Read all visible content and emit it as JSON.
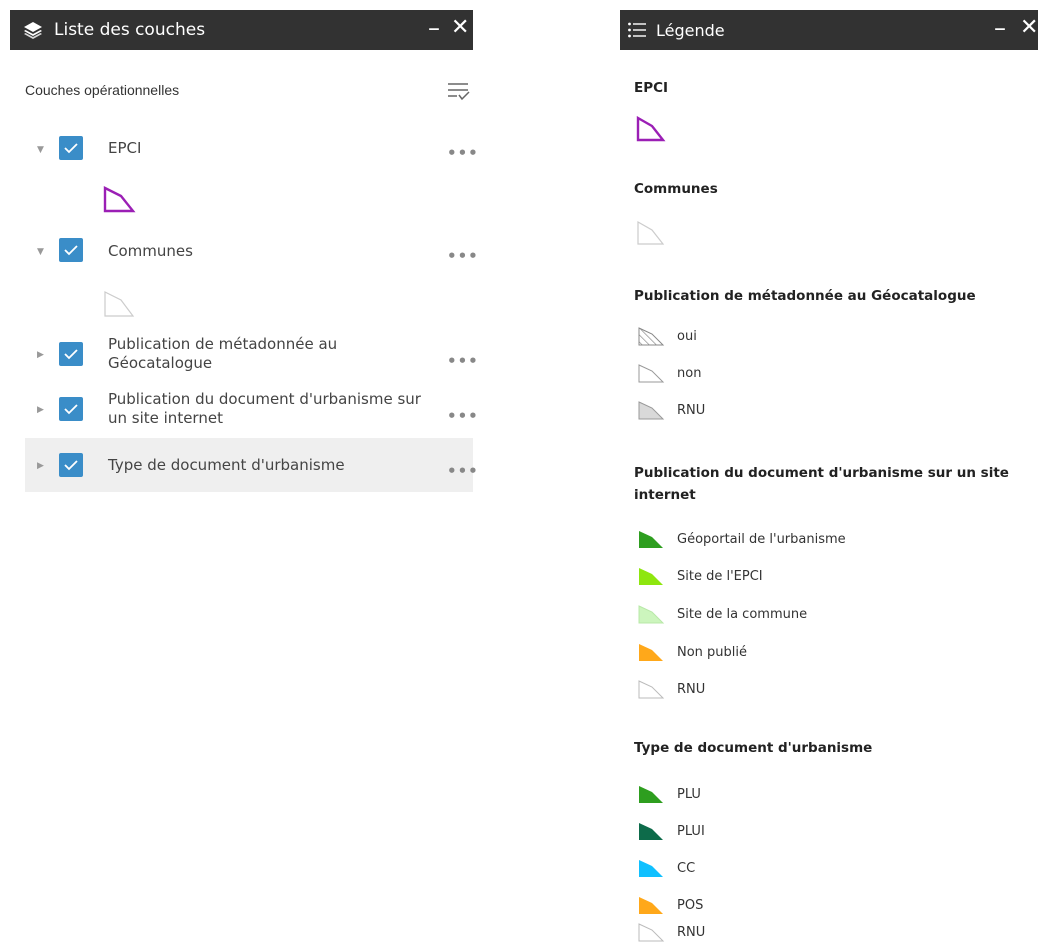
{
  "layers_panel": {
    "title": "Liste des couches",
    "minimize": "–",
    "close": "✕",
    "section_title": "Couches opérationnelles",
    "more": "•••",
    "layers": [
      {
        "label": "EPCI",
        "checked": true,
        "expanded": true
      },
      {
        "label": "Communes",
        "checked": true,
        "expanded": true
      },
      {
        "label": "Publication de métadonnée au Géocatalogue",
        "checked": true,
        "expanded": false
      },
      {
        "label": "Publication du document d'urbanisme sur un site internet",
        "checked": true,
        "expanded": false
      },
      {
        "label": "Type de document d'urbanisme",
        "checked": true,
        "expanded": false
      }
    ]
  },
  "legend_panel": {
    "title": "Légende",
    "minimize": "–",
    "close": "✕",
    "groups": [
      {
        "heading": "EPCI",
        "items": [
          {
            "label": "",
            "fill": "none",
            "stroke": "#9b1fb5"
          }
        ]
      },
      {
        "heading": "Communes",
        "items": [
          {
            "label": "",
            "fill": "#ffffff",
            "stroke": "#cccccc"
          }
        ]
      },
      {
        "heading": "Publication de métadonnée au Géocatalogue",
        "items": [
          {
            "label": "oui",
            "fill": "hatch",
            "stroke": "#999999"
          },
          {
            "label": "non",
            "fill": "#ffffff",
            "stroke": "#999999"
          },
          {
            "label": "RNU",
            "fill": "#d9d9d9",
            "stroke": "#999999"
          }
        ]
      },
      {
        "heading": "Publication du document d'urbanisme sur un site internet",
        "items": [
          {
            "label": "Géoportail de l'urbanisme",
            "fill": "#2e9e1f",
            "stroke": "#2e9e1f"
          },
          {
            "label": "Site de l'EPCI",
            "fill": "#8ee60f",
            "stroke": "#8ee60f"
          },
          {
            "label": "Site de la commune",
            "fill": "#ccf5bd",
            "stroke": "#b8e8a8"
          },
          {
            "label": "Non publié",
            "fill": "#ffa81a",
            "stroke": "#ffa81a"
          },
          {
            "label": "RNU",
            "fill": "#ffffff",
            "stroke": "#bbbbbb"
          }
        ]
      },
      {
        "heading": "Type de document d'urbanisme",
        "items": [
          {
            "label": "PLU",
            "fill": "#2e9e1f",
            "stroke": "#2e9e1f"
          },
          {
            "label": "PLUI",
            "fill": "#0d6b4a",
            "stroke": "#0d6b4a"
          },
          {
            "label": "CC",
            "fill": "#10c0ff",
            "stroke": "#10c0ff"
          },
          {
            "label": "POS",
            "fill": "#ffa81a",
            "stroke": "#ffa81a"
          },
          {
            "label": "RNU",
            "fill": "#ffffff",
            "stroke": "#bbbbbb"
          }
        ]
      }
    ]
  },
  "colors": {
    "header_bg": "#323232",
    "checkbox": "#3a8dc8",
    "highlight_row": "#efefef"
  }
}
